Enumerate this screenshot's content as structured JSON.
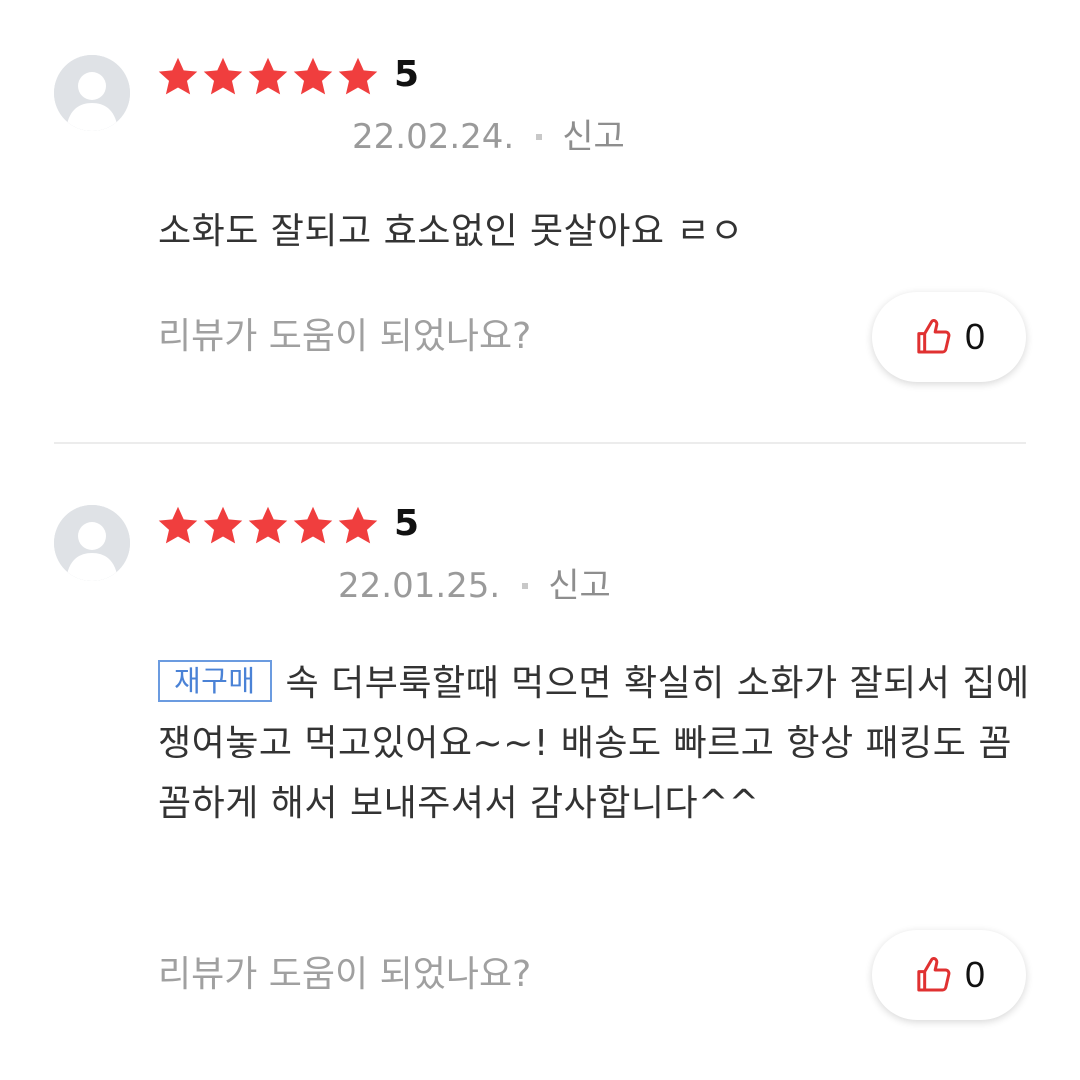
{
  "reviews": [
    {
      "rating": 5,
      "score_text": "5",
      "date": "22.02.24.",
      "report_label": "신고",
      "tag": "",
      "body": "소화도 잘되고 효소없인 못살아요 ㄹㅇ",
      "helpful_question": "리뷰가 도움이 되었나요?",
      "like_count": "0"
    },
    {
      "rating": 5,
      "score_text": "5",
      "date": "22.01.25.",
      "report_label": "신고",
      "tag": "재구매",
      "body": "속 더부룩할때 먹으면 확실히 소화가 잘되서 집에 쟁여놓고 먹고있어요~~! 배송도 빠르고 항상 패킹도 꼼꼼하게 해서 보내주셔서 감사합니다^^",
      "helpful_question": "리뷰가 도움이 되었나요?",
      "like_count": "0"
    }
  ],
  "icons": {
    "star": "star-icon",
    "thumb": "thumbs-up-icon",
    "avatar": "default-user-avatar"
  },
  "colors": {
    "star": "#f03e3e",
    "thumb": "#e03131",
    "tag_border": "#6b9be0",
    "tag_text": "#4a82d6",
    "muted": "#9a9a9a"
  }
}
